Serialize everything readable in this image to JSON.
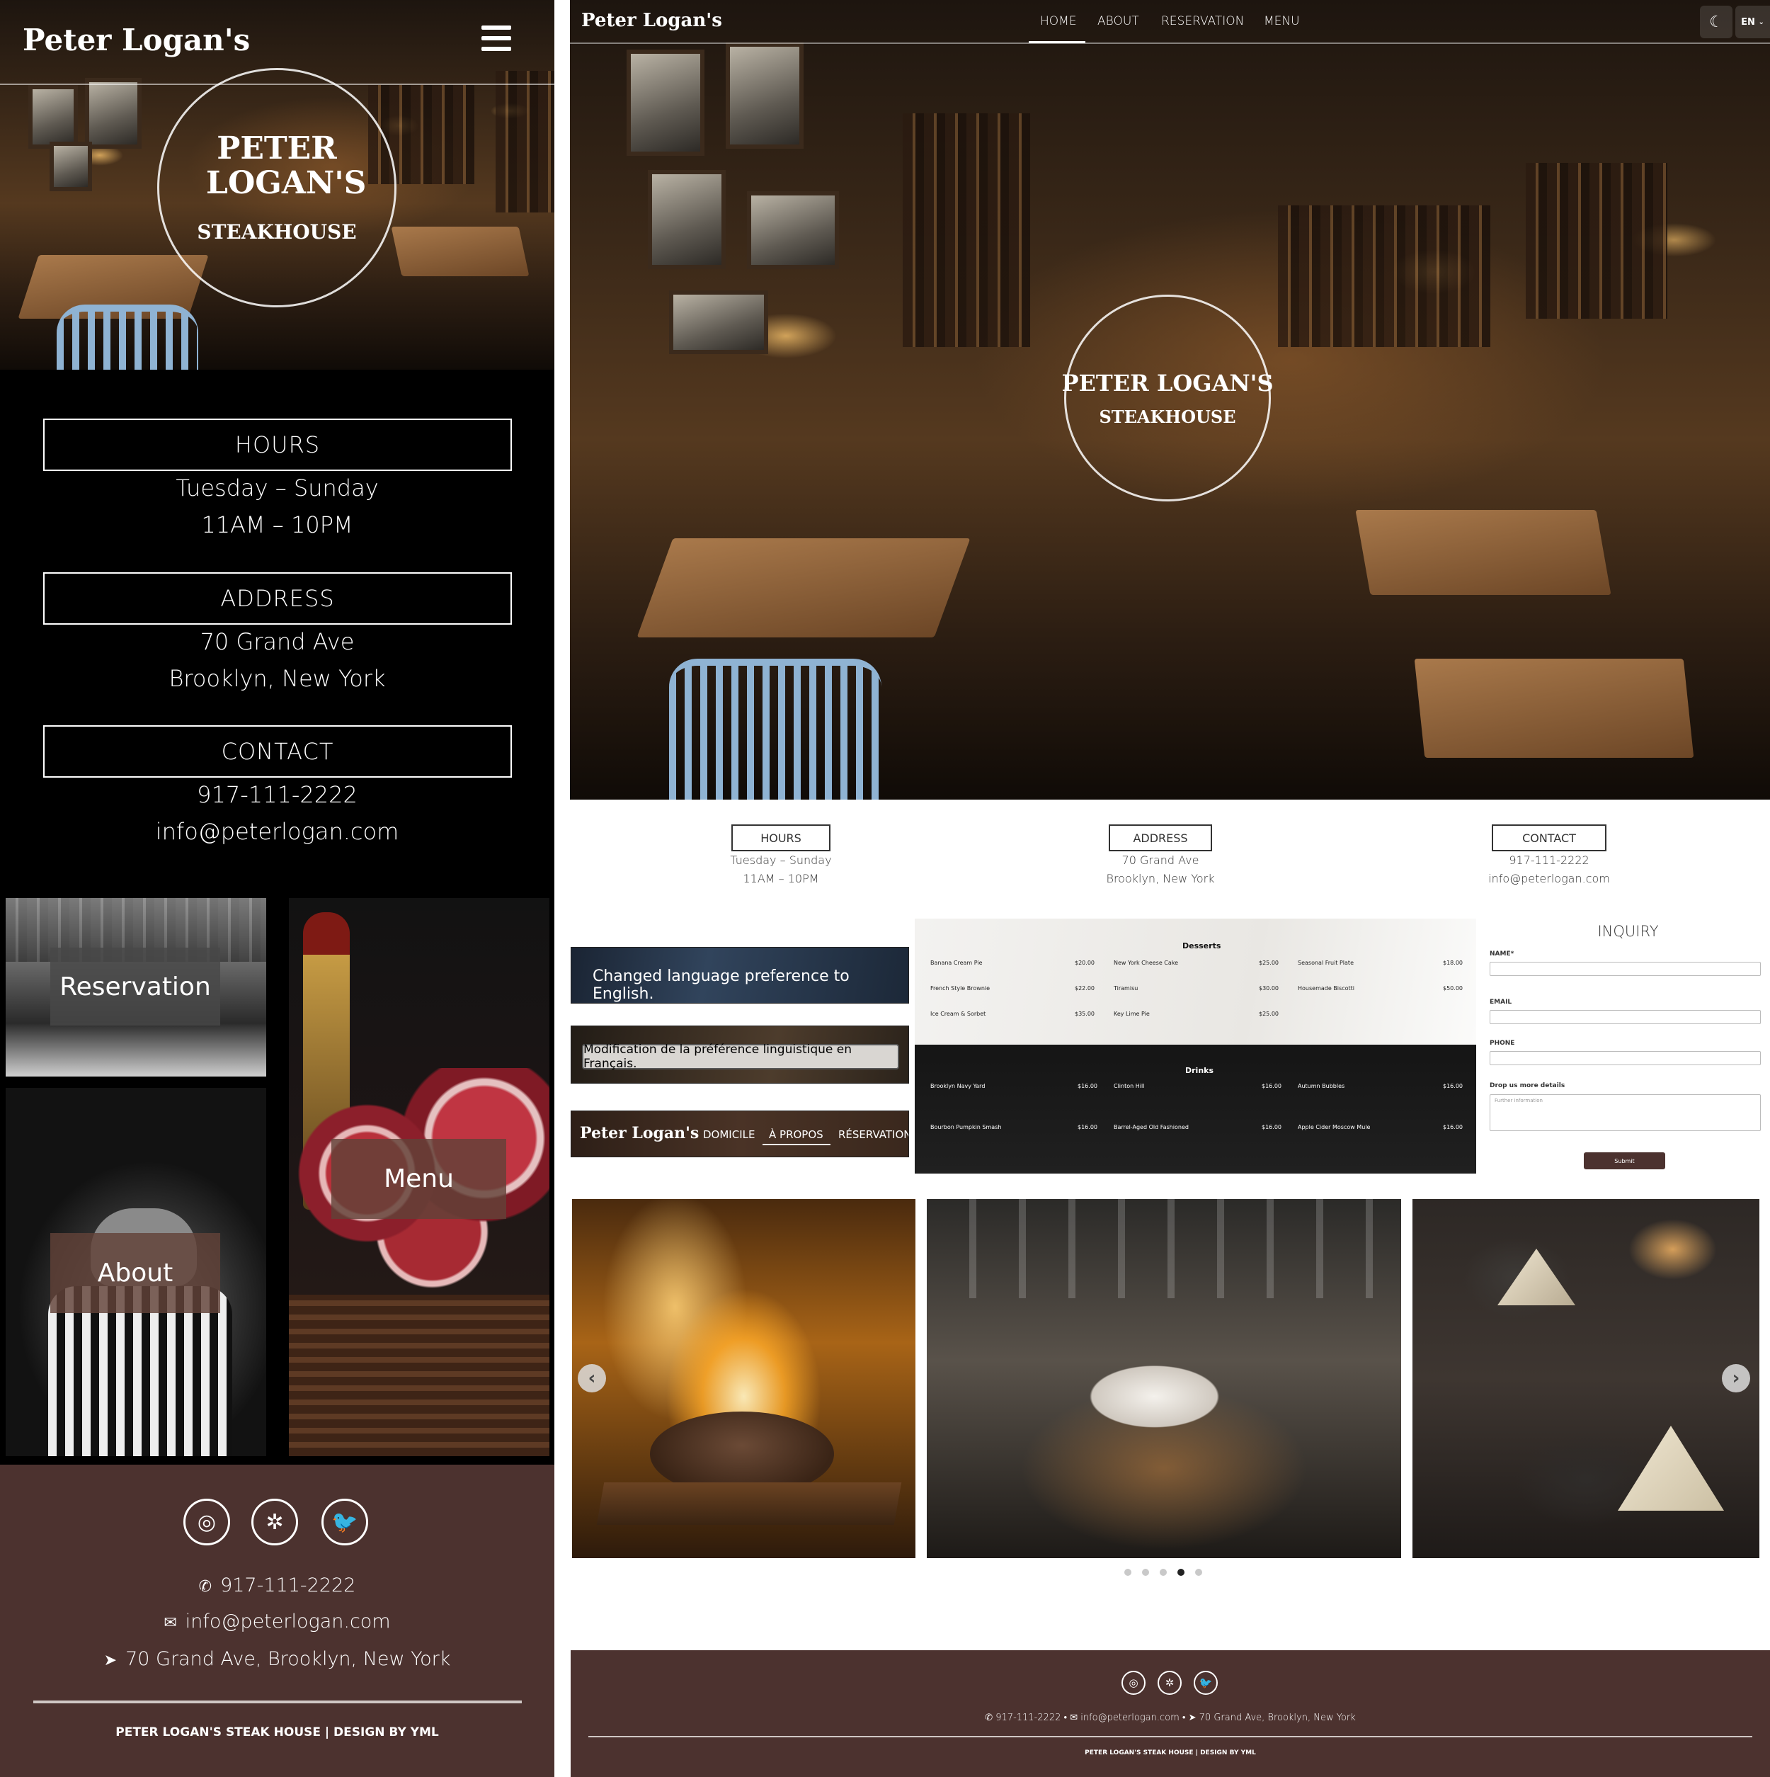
{
  "colors": {
    "brand_brown": "#4c322f",
    "tile_label": "#62423899",
    "black": "#000000",
    "white": "#ffffff"
  },
  "mobile": {
    "brand": "Peter Logan's",
    "menu_icon": "hamburger-icon",
    "hero_circle": {
      "line1": "PETER LOGAN'S",
      "line2": "STEAKHOUSE"
    },
    "hours": {
      "label": "HOURS",
      "line1": "Tuesday – Sunday",
      "line2": "11AM – 10PM"
    },
    "address": {
      "label": "ADDRESS",
      "line1": "70 Grand Ave",
      "line2": "Brooklyn, New York"
    },
    "contact": {
      "label": "CONTACT",
      "line1": "917-111-2222",
      "line2": "info@peterlogan.com"
    },
    "tiles": {
      "reservation": "Reservation",
      "menu": "Menu",
      "about": "About"
    },
    "footer": {
      "social_icons": [
        "instagram-icon",
        "yelp-icon",
        "twitter-icon"
      ],
      "phone": "917-111-2222",
      "email": "info@peterlogan.com",
      "address": "70 Grand Ave, Brooklyn, New York",
      "copyright": "PETER LOGAN'S STEAK HOUSE | DESIGN BY YML"
    }
  },
  "desktop": {
    "brand": "Peter Logan's",
    "nav": [
      "HOME",
      "ABOUT",
      "RESERVATION",
      "MENU"
    ],
    "active_nav": "HOME",
    "theme_icon": "moon-icon",
    "language": "EN",
    "hero_circle": {
      "line1": "PETER LOGAN'S",
      "line2": "STEAKHOUSE"
    },
    "info": {
      "hours": {
        "label": "HOURS",
        "line1": "Tuesday – Sunday",
        "line2": "11AM – 10PM"
      },
      "address": {
        "label": "ADDRESS",
        "line1": "70 Grand Ave",
        "line2": "Brooklyn, New York"
      },
      "contact": {
        "label": "CONTACT",
        "line1": "917-111-2222",
        "line2": "info@peterlogan.com"
      }
    },
    "toasts": {
      "english": "Changed language preference to English.",
      "french": "Modification de la préférence linguistique en Français."
    },
    "fr_nav": {
      "brand": "Peter Logan's",
      "items": [
        "DOMICILE",
        "À PROPOS",
        "RÉSERVATION"
      ]
    },
    "menu_card": {
      "desserts_title": "Desserts",
      "desserts": [
        {
          "name": "Banana Cream Pie",
          "price": "$20.00"
        },
        {
          "name": "New York Cheese Cake",
          "price": "$25.00"
        },
        {
          "name": "Seasonal Fruit Plate",
          "price": "$18.00"
        },
        {
          "name": "French Style Brownie",
          "price": "$22.00"
        },
        {
          "name": "Tiramisu",
          "price": "$30.00"
        },
        {
          "name": "Housemade Biscotti",
          "price": "$50.00"
        },
        {
          "name": "Ice Cream & Sorbet",
          "price": "$35.00"
        },
        {
          "name": "Key Lime Pie",
          "price": "$25.00"
        }
      ],
      "drinks_title": "Drinks",
      "drinks": [
        {
          "name": "Brooklyn Navy Yard",
          "price": "$16.00"
        },
        {
          "name": "Clinton Hill",
          "price": "$16.00"
        },
        {
          "name": "Autumn Bubbles",
          "price": "$16.00"
        },
        {
          "name": "Bourbon Pumpkin Smash",
          "price": "$16.00"
        },
        {
          "name": "Barrel-Aged Old Fashioned",
          "price": "$16.00"
        },
        {
          "name": "Apple Cider Moscow Mule",
          "price": "$16.00"
        }
      ]
    },
    "inquiry": {
      "title": "INQUIRY",
      "name_label": "NAME*",
      "email_label": "EMAIL",
      "phone_label": "PHONE",
      "details_label": "Drop us more details",
      "details_placeholder": "Further information",
      "submit": "Submit"
    },
    "carousel": {
      "prev_icon": "chevron-left-icon",
      "next_icon": "chevron-right-icon",
      "dots": 5,
      "active_dot": 4
    },
    "footer": {
      "social_icons": [
        "instagram-icon",
        "yelp-icon",
        "twitter-icon"
      ],
      "phone": "917-111-2222",
      "email": "info@peterlogan.com",
      "address": "70 Grand Ave, Brooklyn, New York",
      "copyright": "PETER LOGAN'S STEAK HOUSE | DESIGN BY YML"
    }
  }
}
